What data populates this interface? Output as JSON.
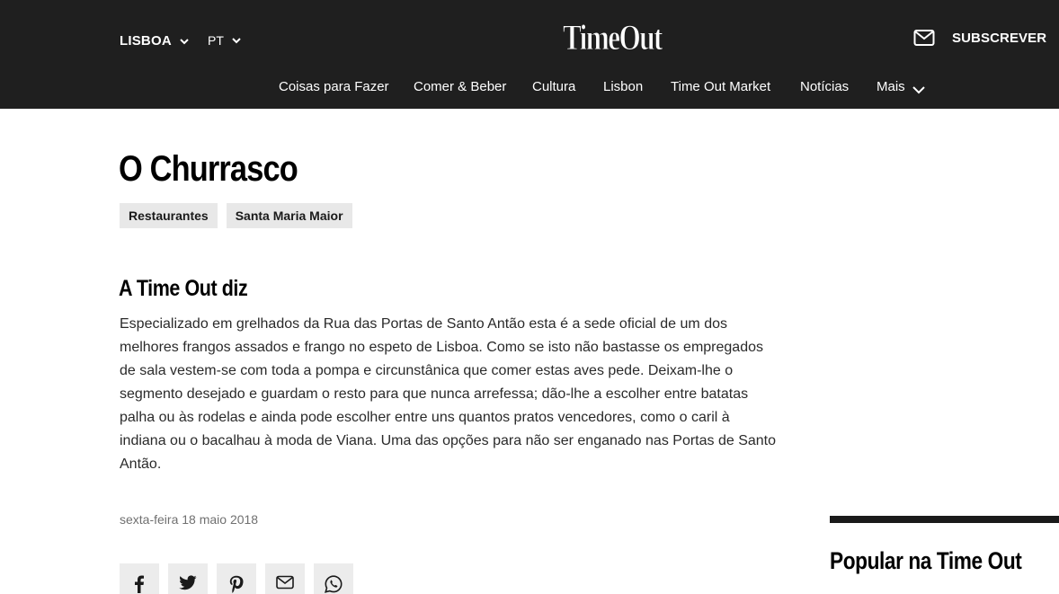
{
  "header": {
    "city": "LISBOA",
    "language": "PT",
    "logo_text": "TimeOut",
    "subscribe_label": "SUBSCREVER",
    "nav": [
      {
        "label": "Coisas para Fazer"
      },
      {
        "label": "Comer & Beber"
      },
      {
        "label": "Cultura"
      },
      {
        "label": "Lisbon"
      },
      {
        "label": "Time Out Market"
      },
      {
        "label": "Notícias"
      },
      {
        "label": "Mais"
      }
    ]
  },
  "article": {
    "title": "O Churrasco",
    "tags": [
      "Restaurantes",
      "Santa Maria Maior"
    ],
    "section_heading": "A Time Out diz",
    "body": "Especializado em grelhados da Rua das Portas de Santo Antão esta é a sede oficial de um dos melhores frangos assados e frango no espeto de Lisboa. Como se isto não bastasse os empregados de sala vestem-se com toda a pompa e circunstânica que comer estas aves pede. Deixam-lhe o segmento desejado e guardam o resto para que nunca arrefessa; dão-lhe a escolher entre batatas palha ou às rodelas e ainda pode escolher entre uns quantos pratos vencedores, como o caril à indiana ou o bacalhau à moda de Viana. Uma das opções para não ser enganado nas Portas de Santo Antão.",
    "date": "sexta-feira 18 maio 2018",
    "share_icons": [
      "facebook-icon",
      "twitter-icon",
      "pinterest-icon",
      "email-icon",
      "whatsapp-icon"
    ]
  },
  "sidebar": {
    "popular_heading": "Popular na Time Out"
  },
  "colors": {
    "header_bg": "#1f1f1f",
    "tag_bg": "#e8e8e8",
    "share_bg": "#ececec"
  }
}
